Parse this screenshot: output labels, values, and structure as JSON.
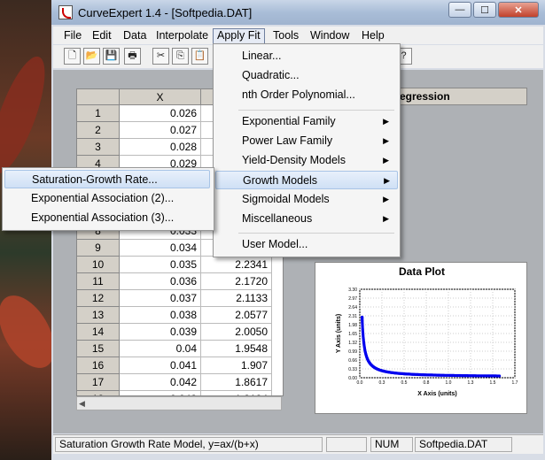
{
  "window": {
    "title": "CurveExpert 1.4 - [Softpedia.DAT]"
  },
  "window_buttons": {
    "minimize": "—",
    "maximize": "☐",
    "close": "✕"
  },
  "menubar": [
    "File",
    "Edit",
    "Data",
    "Interpolate",
    "Apply Fit",
    "Tools",
    "Window",
    "Help"
  ],
  "toolbar": {
    "new": "🗋",
    "open": "📂",
    "save": "💾",
    "print": "🖶",
    "cut": "✂",
    "copy": "⎘",
    "paste": "📋",
    "help": "?"
  },
  "grid": {
    "col_x": "X",
    "rows": [
      {
        "n": "1",
        "x": "0.026",
        "y": ""
      },
      {
        "n": "2",
        "x": "0.027",
        "y": ""
      },
      {
        "n": "3",
        "x": "0.028",
        "y": ""
      },
      {
        "n": "4",
        "x": "0.029",
        "y": ""
      },
      {
        "n": "5",
        "x": "",
        "y": ""
      },
      {
        "n": "6",
        "x": "",
        "y": ""
      },
      {
        "n": "7",
        "x": "",
        "y": ""
      },
      {
        "n": "8",
        "x": "0.033",
        "y": ""
      },
      {
        "n": "9",
        "x": "0.034",
        "y": ""
      },
      {
        "n": "10",
        "x": "0.035",
        "y": "2.2341"
      },
      {
        "n": "11",
        "x": "0.036",
        "y": "2.1720"
      },
      {
        "n": "12",
        "x": "0.037",
        "y": "2.1133"
      },
      {
        "n": "13",
        "x": "0.038",
        "y": "2.0577"
      },
      {
        "n": "14",
        "x": "0.039",
        "y": "2.0050"
      },
      {
        "n": "15",
        "x": "0.04",
        "y": "1.9548"
      },
      {
        "n": "16",
        "x": "0.041",
        "y": "1.907"
      },
      {
        "n": "17",
        "x": "0.042",
        "y": "1.8617"
      },
      {
        "n": "18",
        "x": "0.043",
        "y": "1.8184"
      }
    ]
  },
  "regression": {
    "header": "Regression"
  },
  "plot": {
    "title": "Data Plot",
    "xlabel": "X Axis (units)",
    "ylabel": "Y Axis (units)",
    "xticks": [
      "0.0",
      "0.3",
      "0.5",
      "0.8",
      "1.0",
      "1.3",
      "1.5",
      "1.7"
    ],
    "yticks": [
      "0.00",
      "0.33",
      "0.66",
      "0.99",
      "1.32",
      "1.65",
      "1.98",
      "2.31",
      "2.64",
      "2.97",
      "3.30"
    ],
    "curve_color": "#0000ee"
  },
  "apply_fit_menu": {
    "items": [
      "Linear...",
      "Quadratic...",
      "nth Order Polynomial...",
      "Exponential Family",
      "Power Law Family",
      "Yield-Density Models",
      "Growth Models",
      "Sigmoidal Models",
      "Miscellaneous",
      "User Model..."
    ]
  },
  "growth_submenu": {
    "items": [
      "Saturation-Growth Rate...",
      "Exponential Association (2)...",
      "Exponential Association (3)..."
    ]
  },
  "statusbar": {
    "message": "Saturation Growth Rate Model, y=ax/(b+x)",
    "num": "NUM",
    "file": "Softpedia.DAT"
  }
}
